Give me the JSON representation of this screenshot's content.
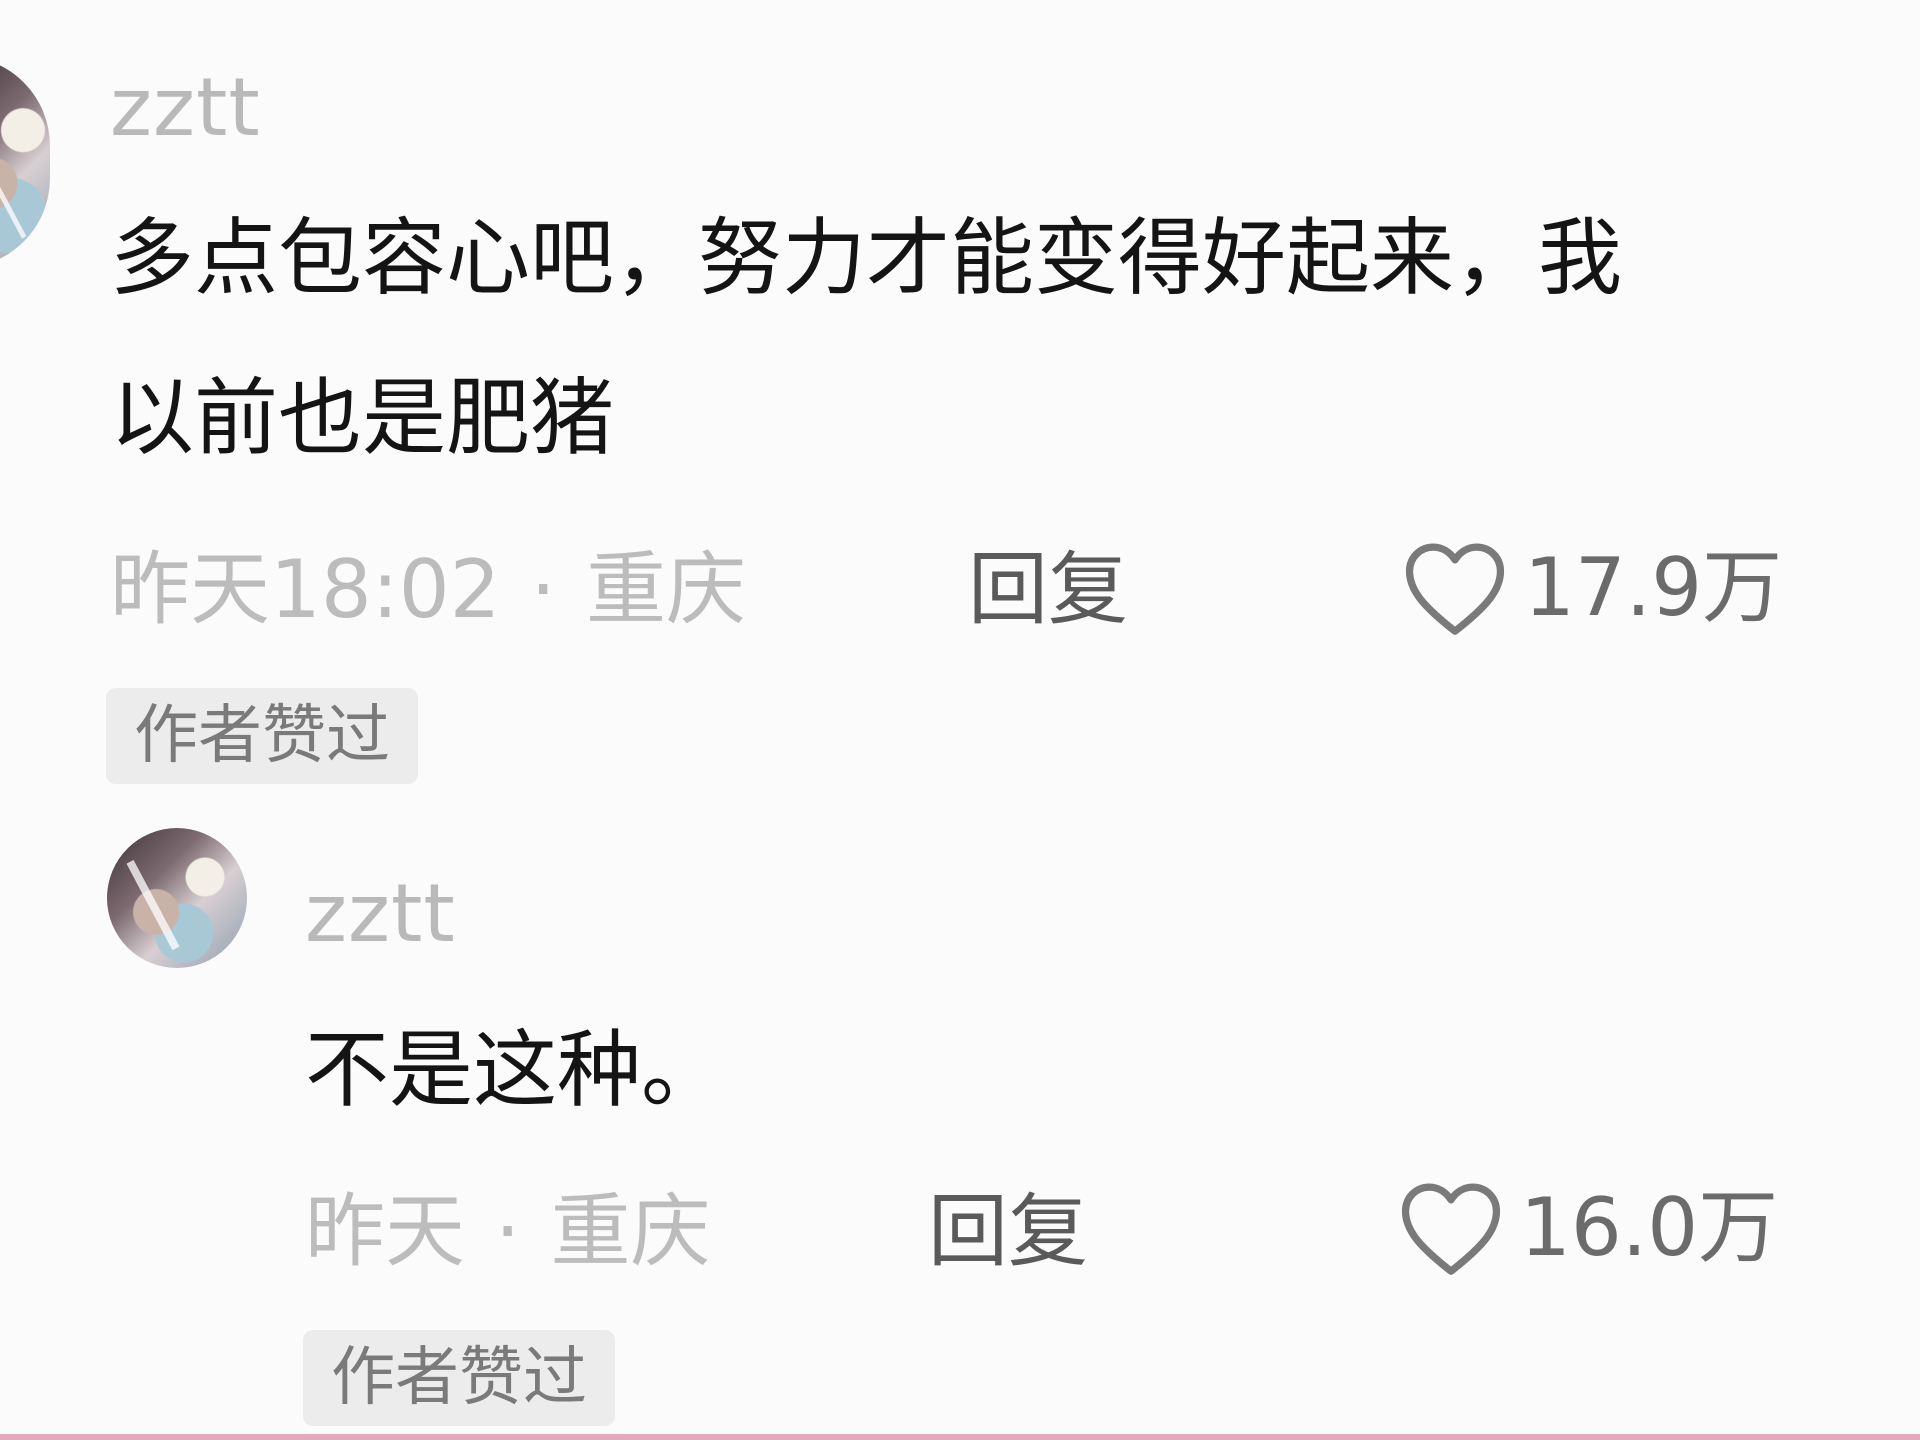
{
  "comment": {
    "username": "zztt",
    "text_line1": "多点包容心吧，努力才能变得好起来，我",
    "text_line2": "以前也是肥猪",
    "time": "昨天18:02",
    "separator": "·",
    "location": "重庆",
    "reply_label": "回复",
    "like_count": "17.9万",
    "badge": "作者赞过"
  },
  "reply": {
    "username": "zztt",
    "text": "不是这种。",
    "time": "昨天",
    "separator": "·",
    "location": "重庆",
    "reply_label": "回复",
    "like_count": "16.0万",
    "badge": "作者赞过"
  },
  "colors": {
    "background": "#fbfbfb",
    "username": "#b9b9b9",
    "text": "#141414",
    "meta": "#bcbcbc",
    "badge_bg": "#ececec",
    "accent_line": "#e6a8bd"
  }
}
